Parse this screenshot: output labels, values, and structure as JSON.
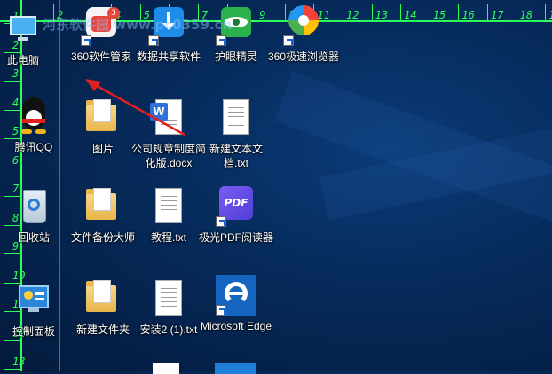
{
  "ruler": {
    "top_numbers": [
      "2",
      "3",
      "4",
      "5",
      "6",
      "7",
      "8",
      "9",
      "10",
      "11",
      "12",
      "13",
      "14",
      "15",
      "16",
      "17",
      "18",
      "19"
    ],
    "left_numbers": [
      "1",
      "2",
      "3",
      "4",
      "5",
      "6",
      "7",
      "8",
      "9",
      "10",
      "11",
      "12",
      "13"
    ]
  },
  "badge": "3",
  "watermark": "河东软件园 www.pc0359.cn",
  "icons": {
    "this_pc": "此电脑",
    "qq": "腾讯QQ",
    "recycle": "回收站",
    "control_panel": "控制面板",
    "s360_manager": "360软件管家",
    "data_share": "数据共享软件",
    "eye_care": "护眼精灵",
    "browser360": "360极速浏览器",
    "pictures": "图片",
    "company_doc": "公司规章制度简化版.docx",
    "new_text": "新建文本文档.txt",
    "backup_master": "文件备份大师",
    "tutorial": "教程.txt",
    "aurora_pdf": "极光PDF阅读器",
    "new_folder": "新建文件夹",
    "install2": "安装2 (1).txt",
    "edge": "Microsoft Edge"
  },
  "colors": {
    "ruler_green": "#2bff58",
    "guide_red": "#e0303a",
    "annotation_arrow": "#e02020"
  }
}
